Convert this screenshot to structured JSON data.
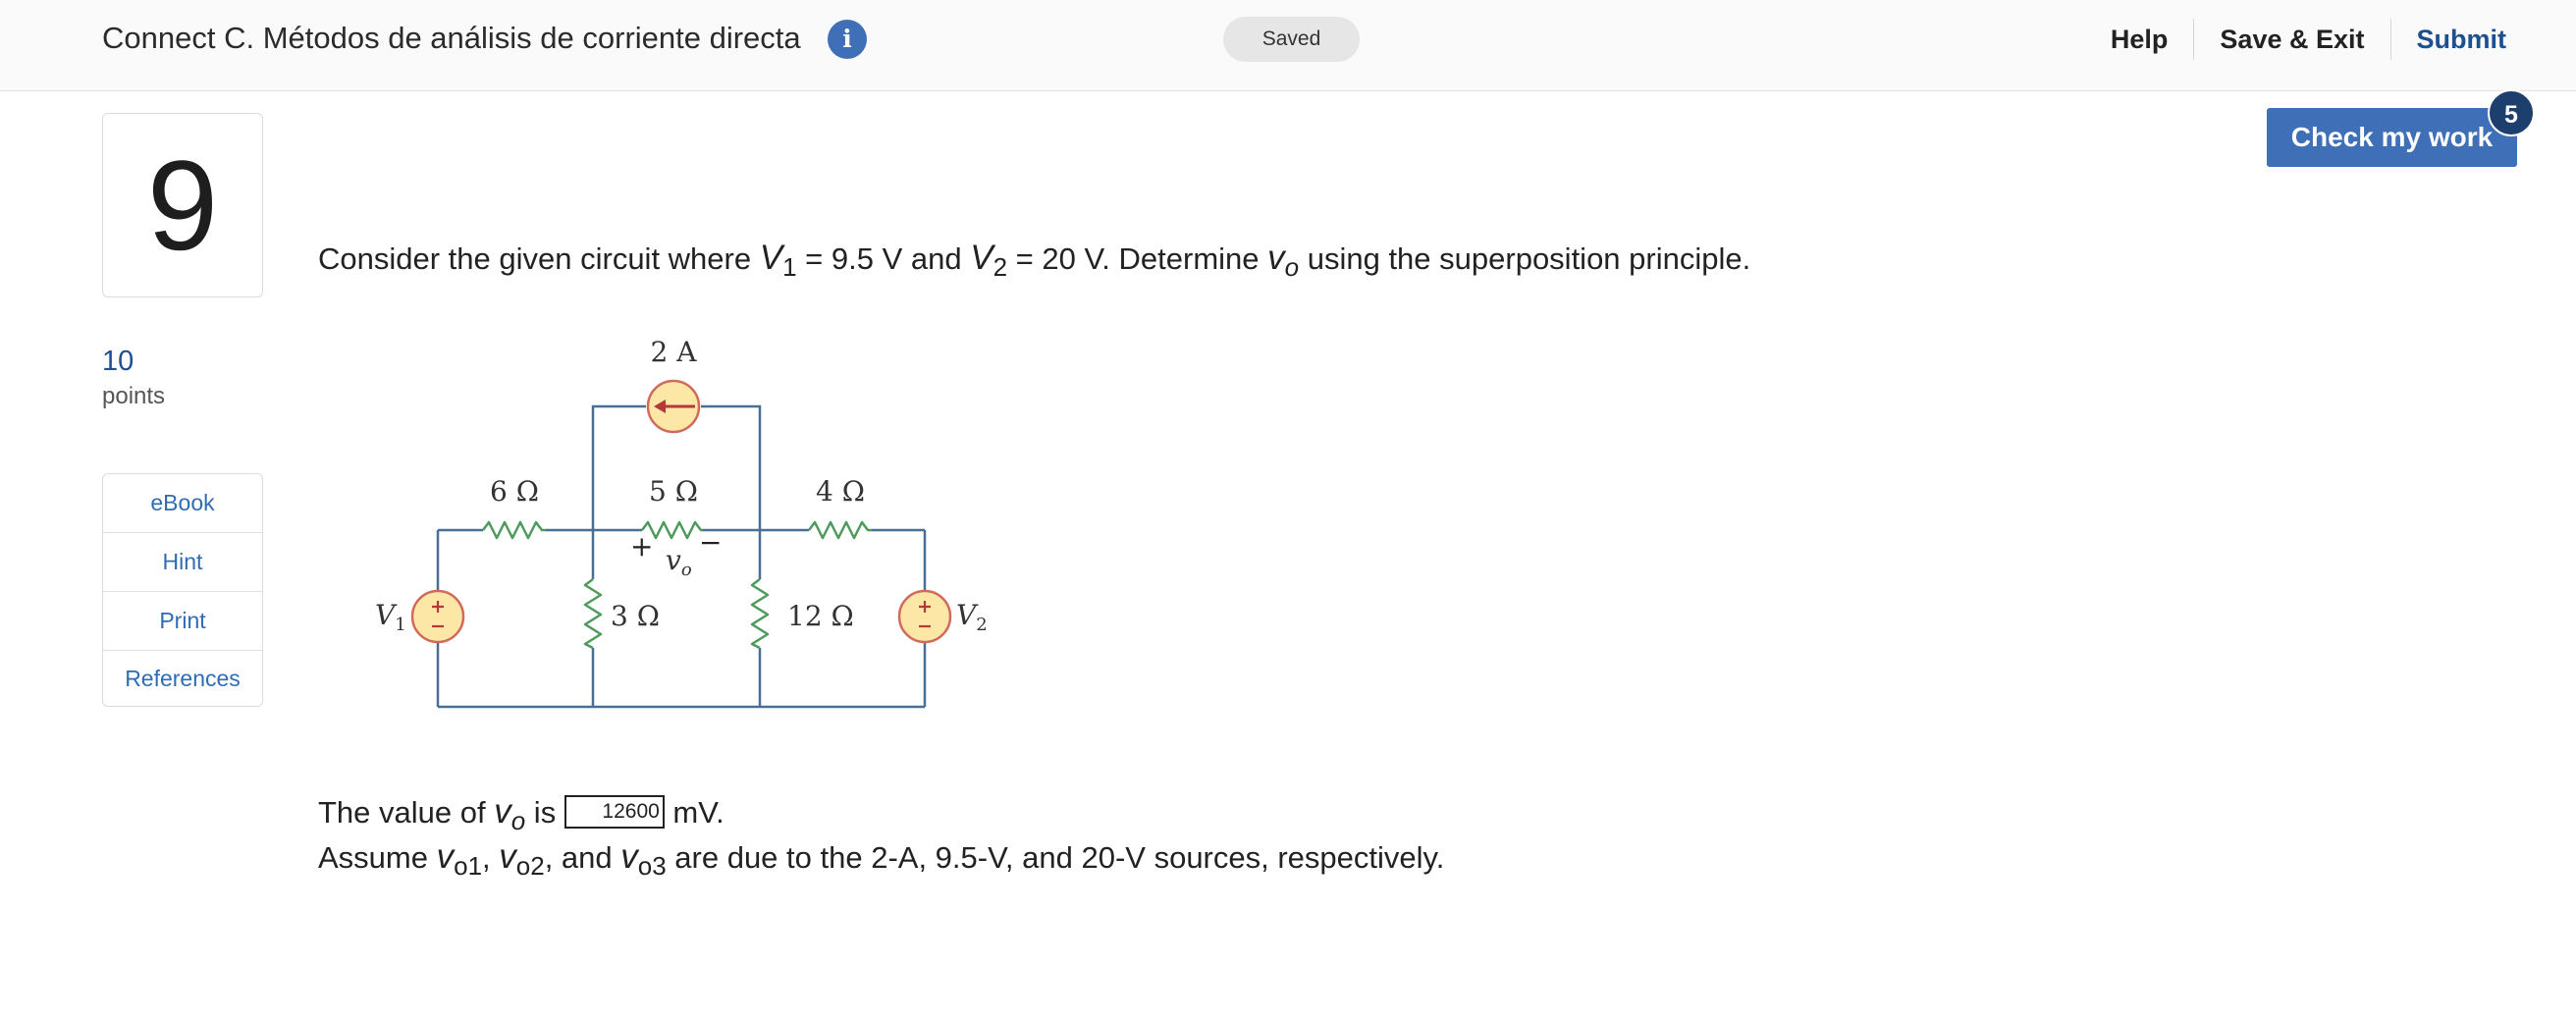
{
  "header": {
    "title": "Connect C. Métodos de análisis de corriente directa",
    "saved_label": "Saved",
    "help_label": "Help",
    "save_exit_label": "Save & Exit",
    "submit_label": "Submit",
    "info_glyph": "i"
  },
  "question": {
    "number": "9",
    "points_value": "10",
    "points_label": "points",
    "tools": [
      "eBook",
      "Hint",
      "Print",
      "References"
    ],
    "check_work_label": "Check my work",
    "check_work_count": "5",
    "prompt": {
      "p1": "Consider the given circuit where ",
      "v1_var": "V",
      "v1_sub": "1",
      "p2": " = 9.5 V and ",
      "v2_var": "V",
      "v2_sub": "2",
      "p3": " = 20 V. Determine ",
      "vo_var": "v",
      "vo_sub": "o",
      "p4": " using the superposition principle."
    },
    "answer": {
      "prefix": "The value of ",
      "var": "v",
      "var_sub": "o",
      "mid": " is ",
      "input_value": "12600",
      "unit": " mV."
    },
    "assume": {
      "prefix": "Assume ",
      "v1": "v",
      "v1_sub": "o1",
      "sep1": ", ",
      "v2": "v",
      "v2_sub": "o2",
      "sep2": ", and ",
      "v3": "v",
      "v3_sub": "o3",
      "suffix": " are due to the 2-A, 9.5-V, and 20-V sources, respectively."
    }
  },
  "circuit": {
    "current_source_label": "2 A",
    "r6_label": "6 Ω",
    "r5_label": "5 Ω",
    "r4_label": "4 Ω",
    "r3_label": "3 Ω",
    "r12_label": "12 Ω",
    "v1_label": "V",
    "v1_sub": "1",
    "v2_label": "V",
    "v2_sub": "2",
    "vo_label": "v",
    "vo_sub": "o",
    "plus": "+",
    "minus": "−",
    "wire_color": "#4a6f96",
    "resistor_color": "#4d9a5c",
    "source_fill": "#fde7a6",
    "source_stroke": "#d06a5a"
  }
}
